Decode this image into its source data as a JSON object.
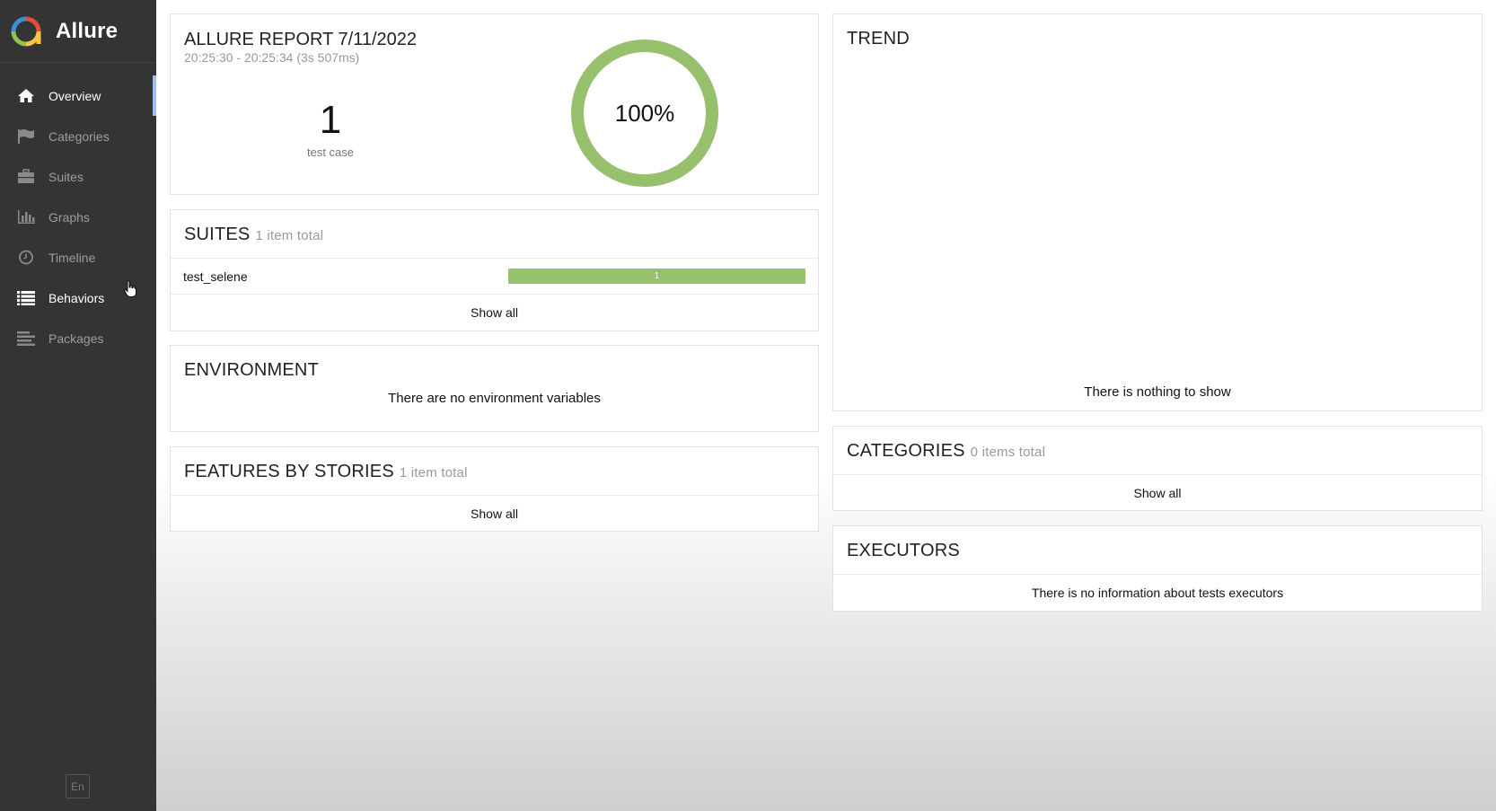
{
  "brand": {
    "name": "Allure"
  },
  "sidebar": {
    "items": [
      {
        "label": "Overview"
      },
      {
        "label": "Categories"
      },
      {
        "label": "Suites"
      },
      {
        "label": "Graphs"
      },
      {
        "label": "Timeline"
      },
      {
        "label": "Behaviors"
      },
      {
        "label": "Packages"
      }
    ],
    "language": "En"
  },
  "summary": {
    "title": "ALLURE REPORT 7/11/2022",
    "time": "20:25:30 - 20:25:34 (3s 507ms)",
    "count": "1",
    "count_label": "test case",
    "percent": "100%",
    "pass_fraction": 1.0
  },
  "suites": {
    "title": "SUITES",
    "subtitle": "1 item total",
    "rows": [
      {
        "name": "test_selene",
        "passed": "1"
      }
    ],
    "show_all": "Show all"
  },
  "environment": {
    "title": "ENVIRONMENT",
    "message": "There are no environment variables"
  },
  "features": {
    "title": "FEATURES BY STORIES",
    "subtitle": "1 item total",
    "show_all": "Show all"
  },
  "trend": {
    "title": "TREND",
    "message": "There is nothing to show"
  },
  "categories": {
    "title": "CATEGORIES",
    "subtitle": "0 items total",
    "show_all": "Show all"
  },
  "executors": {
    "title": "EXECUTORS",
    "message": "There is no information about tests executors"
  },
  "colors": {
    "sidebar_bg": "#343434",
    "passed": "#97c06d",
    "active_marker": "#9fc0ec"
  }
}
